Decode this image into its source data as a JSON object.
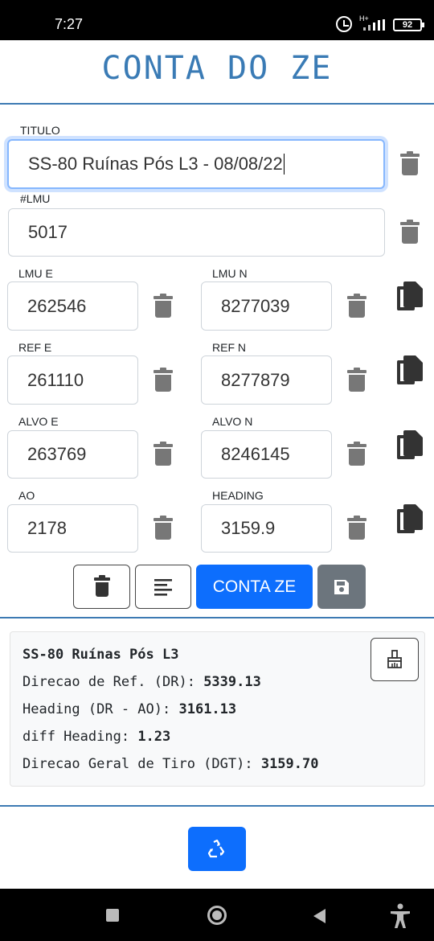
{
  "status_bar": {
    "time": "7:27",
    "network": "H+",
    "battery": "92"
  },
  "header": {
    "title": "CONTA DO ZE"
  },
  "form": {
    "titulo": {
      "label": "TITULO",
      "value": "SS-80 Ruínas Pós L3 - 08/08/22"
    },
    "lmu": {
      "label": "#LMU",
      "value": "5017"
    },
    "lmu_e": {
      "label": "LMU E",
      "value": "262546"
    },
    "lmu_n": {
      "label": "LMU N",
      "value": "8277039"
    },
    "ref_e": {
      "label": "REF E",
      "value": "261110"
    },
    "ref_n": {
      "label": "REF N",
      "value": "8277879"
    },
    "alvo_e": {
      "label": "ALVO E",
      "value": "263769"
    },
    "alvo_n": {
      "label": "ALVO N",
      "value": "8246145"
    },
    "ao": {
      "label": "AO",
      "value": "2178"
    },
    "heading": {
      "label": "HEADING",
      "value": "3159.9"
    }
  },
  "actions": {
    "compute_label": "CONTA ZE"
  },
  "result": {
    "title": "SS-80 Ruínas Pós L3",
    "rows": [
      {
        "label": "Direcao de Ref. (DR):",
        "value": "5339.13"
      },
      {
        "label": "Heading (DR - AO):",
        "value": "3161.13"
      },
      {
        "label": "diff Heading:",
        "value": "1.23"
      },
      {
        "label": "Direcao Geral de Tiro (DGT):",
        "value": "3159.70"
      }
    ]
  },
  "colors": {
    "accent": "#3a7bb5",
    "primary_button": "#0d6efd",
    "save_button": "#6c757d"
  },
  "icons": [
    "trash-icon",
    "copy-icon",
    "align-icon",
    "save-icon",
    "broom-icon",
    "recycle-icon"
  ]
}
